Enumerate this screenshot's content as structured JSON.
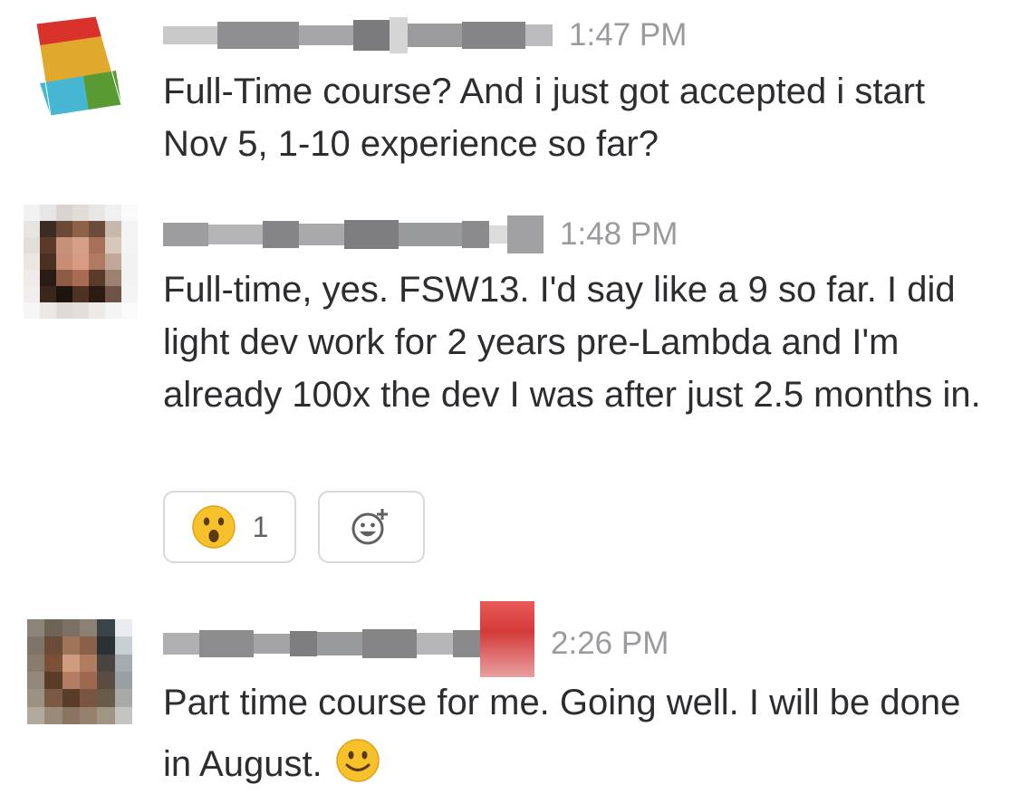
{
  "messages": [
    {
      "time": "1:47 PM",
      "text": "Full-Time course? And i just got accepted i start Nov 5, 1-10 experience so far?"
    },
    {
      "time": "1:48 PM",
      "text": "Full-time, yes. FSW13. I'd say like a 9 so far. I did light dev work for 2 years pre-Lambda and I'm already 100x the dev I was after just 2.5 months in.",
      "reactions": [
        {
          "emoji": "astonished-face",
          "count": "1"
        }
      ]
    },
    {
      "time": "2:26 PM",
      "text": "Part time course for me. Going well. I will be done in August.",
      "trailing_emoji": "slightly-smiling-face"
    }
  ],
  "colors": {
    "text": "#2c2d30",
    "timestamp": "#9a9b9e",
    "reaction_border": "#d8d8da",
    "emoji_yellow": "#f6c12b"
  }
}
